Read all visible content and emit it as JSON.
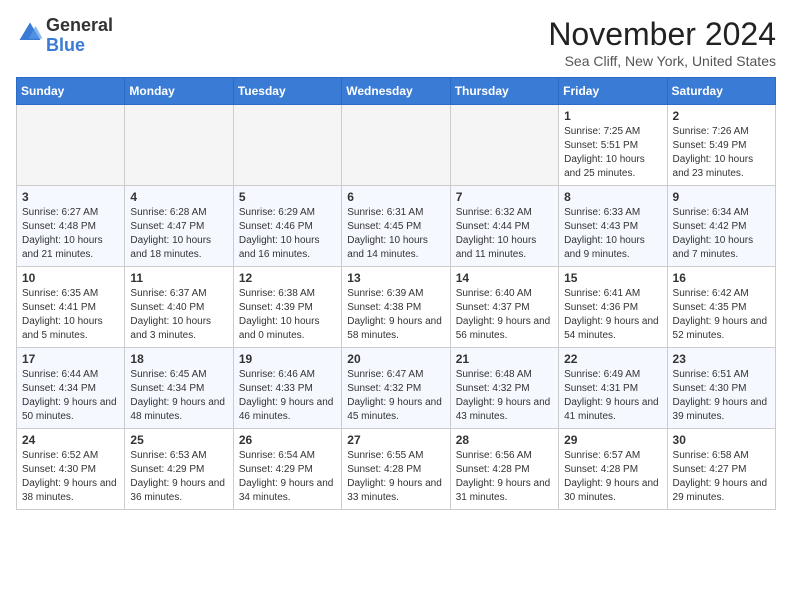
{
  "header": {
    "logo_general": "General",
    "logo_blue": "Blue",
    "month_title": "November 2024",
    "location": "Sea Cliff, New York, United States"
  },
  "days_of_week": [
    "Sunday",
    "Monday",
    "Tuesday",
    "Wednesday",
    "Thursday",
    "Friday",
    "Saturday"
  ],
  "weeks": [
    [
      {
        "day": "",
        "empty": true
      },
      {
        "day": "",
        "empty": true
      },
      {
        "day": "",
        "empty": true
      },
      {
        "day": "",
        "empty": true
      },
      {
        "day": "",
        "empty": true
      },
      {
        "day": "1",
        "sunrise": "Sunrise: 7:25 AM",
        "sunset": "Sunset: 5:51 PM",
        "daylight": "Daylight: 10 hours and 25 minutes."
      },
      {
        "day": "2",
        "sunrise": "Sunrise: 7:26 AM",
        "sunset": "Sunset: 5:49 PM",
        "daylight": "Daylight: 10 hours and 23 minutes."
      }
    ],
    [
      {
        "day": "3",
        "sunrise": "Sunrise: 6:27 AM",
        "sunset": "Sunset: 4:48 PM",
        "daylight": "Daylight: 10 hours and 21 minutes."
      },
      {
        "day": "4",
        "sunrise": "Sunrise: 6:28 AM",
        "sunset": "Sunset: 4:47 PM",
        "daylight": "Daylight: 10 hours and 18 minutes."
      },
      {
        "day": "5",
        "sunrise": "Sunrise: 6:29 AM",
        "sunset": "Sunset: 4:46 PM",
        "daylight": "Daylight: 10 hours and 16 minutes."
      },
      {
        "day": "6",
        "sunrise": "Sunrise: 6:31 AM",
        "sunset": "Sunset: 4:45 PM",
        "daylight": "Daylight: 10 hours and 14 minutes."
      },
      {
        "day": "7",
        "sunrise": "Sunrise: 6:32 AM",
        "sunset": "Sunset: 4:44 PM",
        "daylight": "Daylight: 10 hours and 11 minutes."
      },
      {
        "day": "8",
        "sunrise": "Sunrise: 6:33 AM",
        "sunset": "Sunset: 4:43 PM",
        "daylight": "Daylight: 10 hours and 9 minutes."
      },
      {
        "day": "9",
        "sunrise": "Sunrise: 6:34 AM",
        "sunset": "Sunset: 4:42 PM",
        "daylight": "Daylight: 10 hours and 7 minutes."
      }
    ],
    [
      {
        "day": "10",
        "sunrise": "Sunrise: 6:35 AM",
        "sunset": "Sunset: 4:41 PM",
        "daylight": "Daylight: 10 hours and 5 minutes."
      },
      {
        "day": "11",
        "sunrise": "Sunrise: 6:37 AM",
        "sunset": "Sunset: 4:40 PM",
        "daylight": "Daylight: 10 hours and 3 minutes."
      },
      {
        "day": "12",
        "sunrise": "Sunrise: 6:38 AM",
        "sunset": "Sunset: 4:39 PM",
        "daylight": "Daylight: 10 hours and 0 minutes."
      },
      {
        "day": "13",
        "sunrise": "Sunrise: 6:39 AM",
        "sunset": "Sunset: 4:38 PM",
        "daylight": "Daylight: 9 hours and 58 minutes."
      },
      {
        "day": "14",
        "sunrise": "Sunrise: 6:40 AM",
        "sunset": "Sunset: 4:37 PM",
        "daylight": "Daylight: 9 hours and 56 minutes."
      },
      {
        "day": "15",
        "sunrise": "Sunrise: 6:41 AM",
        "sunset": "Sunset: 4:36 PM",
        "daylight": "Daylight: 9 hours and 54 minutes."
      },
      {
        "day": "16",
        "sunrise": "Sunrise: 6:42 AM",
        "sunset": "Sunset: 4:35 PM",
        "daylight": "Daylight: 9 hours and 52 minutes."
      }
    ],
    [
      {
        "day": "17",
        "sunrise": "Sunrise: 6:44 AM",
        "sunset": "Sunset: 4:34 PM",
        "daylight": "Daylight: 9 hours and 50 minutes."
      },
      {
        "day": "18",
        "sunrise": "Sunrise: 6:45 AM",
        "sunset": "Sunset: 4:34 PM",
        "daylight": "Daylight: 9 hours and 48 minutes."
      },
      {
        "day": "19",
        "sunrise": "Sunrise: 6:46 AM",
        "sunset": "Sunset: 4:33 PM",
        "daylight": "Daylight: 9 hours and 46 minutes."
      },
      {
        "day": "20",
        "sunrise": "Sunrise: 6:47 AM",
        "sunset": "Sunset: 4:32 PM",
        "daylight": "Daylight: 9 hours and 45 minutes."
      },
      {
        "day": "21",
        "sunrise": "Sunrise: 6:48 AM",
        "sunset": "Sunset: 4:32 PM",
        "daylight": "Daylight: 9 hours and 43 minutes."
      },
      {
        "day": "22",
        "sunrise": "Sunrise: 6:49 AM",
        "sunset": "Sunset: 4:31 PM",
        "daylight": "Daylight: 9 hours and 41 minutes."
      },
      {
        "day": "23",
        "sunrise": "Sunrise: 6:51 AM",
        "sunset": "Sunset: 4:30 PM",
        "daylight": "Daylight: 9 hours and 39 minutes."
      }
    ],
    [
      {
        "day": "24",
        "sunrise": "Sunrise: 6:52 AM",
        "sunset": "Sunset: 4:30 PM",
        "daylight": "Daylight: 9 hours and 38 minutes."
      },
      {
        "day": "25",
        "sunrise": "Sunrise: 6:53 AM",
        "sunset": "Sunset: 4:29 PM",
        "daylight": "Daylight: 9 hours and 36 minutes."
      },
      {
        "day": "26",
        "sunrise": "Sunrise: 6:54 AM",
        "sunset": "Sunset: 4:29 PM",
        "daylight": "Daylight: 9 hours and 34 minutes."
      },
      {
        "day": "27",
        "sunrise": "Sunrise: 6:55 AM",
        "sunset": "Sunset: 4:28 PM",
        "daylight": "Daylight: 9 hours and 33 minutes."
      },
      {
        "day": "28",
        "sunrise": "Sunrise: 6:56 AM",
        "sunset": "Sunset: 4:28 PM",
        "daylight": "Daylight: 9 hours and 31 minutes."
      },
      {
        "day": "29",
        "sunrise": "Sunrise: 6:57 AM",
        "sunset": "Sunset: 4:28 PM",
        "daylight": "Daylight: 9 hours and 30 minutes."
      },
      {
        "day": "30",
        "sunrise": "Sunrise: 6:58 AM",
        "sunset": "Sunset: 4:27 PM",
        "daylight": "Daylight: 9 hours and 29 minutes."
      }
    ]
  ]
}
